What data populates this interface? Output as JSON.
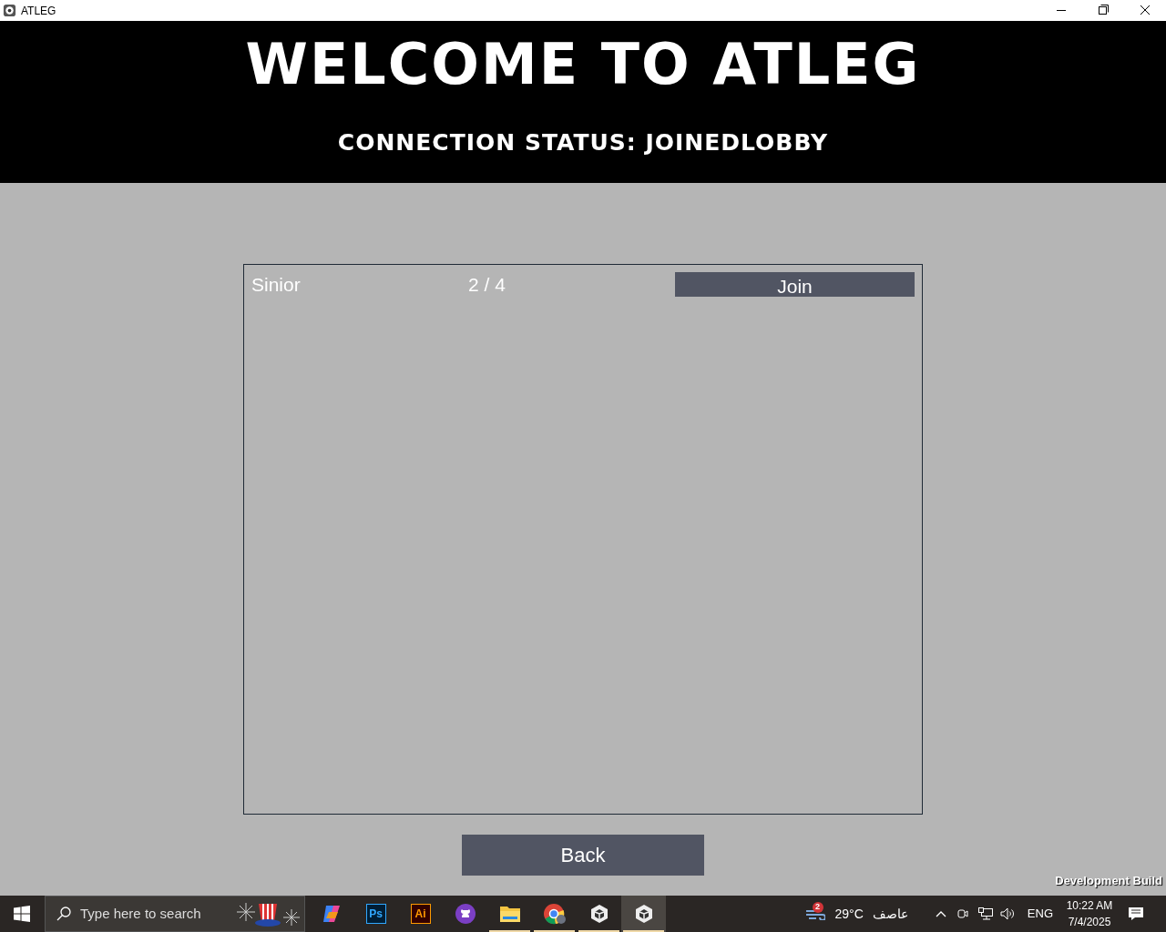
{
  "window": {
    "title": "ATLEG"
  },
  "header": {
    "title": "WELCOME TO ATLEG",
    "status": "CONNECTION STATUS: JOINEDLOBBY"
  },
  "rooms": [
    {
      "name": "Sinior",
      "players": "2 / 4",
      "action": "Join"
    }
  ],
  "back_button": "Back",
  "build_label": "Development Build",
  "taskbar": {
    "search": {
      "placeholder": "Type here to search"
    },
    "apps": [
      {
        "kind": "copilot",
        "running": false,
        "selected": false
      },
      {
        "kind": "photoshop",
        "label": "Ps",
        "running": false,
        "selected": false
      },
      {
        "kind": "illustrator",
        "label": "Ai",
        "running": false,
        "selected": false
      },
      {
        "kind": "github",
        "running": false,
        "selected": false
      },
      {
        "kind": "explorer",
        "running": true,
        "selected": false
      },
      {
        "kind": "chrome",
        "running": true,
        "selected": false
      },
      {
        "kind": "unity",
        "running": true,
        "selected": false
      },
      {
        "kind": "unity",
        "running": true,
        "selected": true
      }
    ],
    "weather": {
      "badge": "2",
      "temperature": "29°C",
      "condition": "عاصف"
    },
    "language": "ENG",
    "time": "10:22 AM",
    "date": "7/4/2025"
  }
}
